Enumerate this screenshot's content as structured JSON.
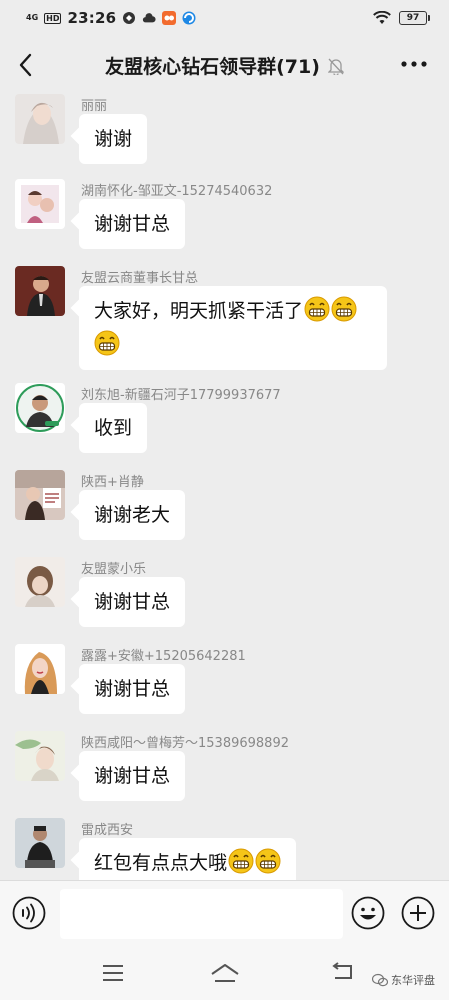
{
  "status_bar": {
    "network": "4G",
    "hd": "HD",
    "time": "23:26",
    "battery": "97"
  },
  "header": {
    "title": "友盟核心钻石领导群(71)"
  },
  "messages": [
    {
      "sender": "丽丽",
      "text": "谢谢"
    },
    {
      "sender": "湖南怀化-邹亚文-15274540632",
      "text": "谢谢甘总"
    },
    {
      "sender": "友盟云商董事长甘总",
      "line1": "大家好，明天抓紧干活了",
      "line1_emoji_count": 2,
      "line2_emoji_count": 1
    },
    {
      "sender": "刘东旭-新疆石河子17799937677",
      "text": "收到"
    },
    {
      "sender": "陕西+肖静",
      "text": "谢谢老大"
    },
    {
      "sender": "友盟蒙小乐",
      "text": "谢谢甘总"
    },
    {
      "sender": "露露+安徽+15205642281",
      "text": "谢谢甘总"
    },
    {
      "sender": "陕西咸阳～曾梅芳～15389698892",
      "text": "谢谢甘总"
    },
    {
      "sender": "雷成西安",
      "text": "红包有点点大哦",
      "emoji_count": 2
    }
  ],
  "watermark": "东华评盘",
  "colors": {
    "background": "#ededed",
    "bubble": "#ffffff",
    "sender_name": "#888888",
    "emoji": "#f5c518"
  }
}
